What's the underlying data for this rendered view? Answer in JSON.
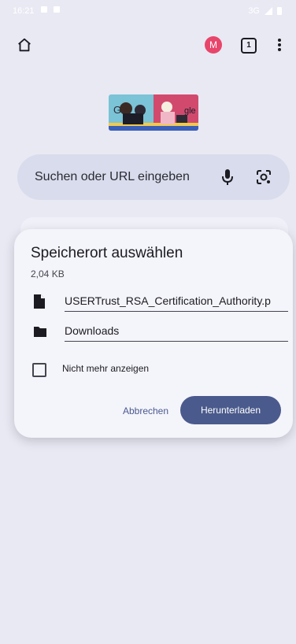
{
  "status_bar": {
    "time": "16:21",
    "network": "3G"
  },
  "toolbar": {
    "account_initial": "M",
    "tab_count": "1"
  },
  "search": {
    "placeholder": "Suchen oder URL eingeben"
  },
  "dialog": {
    "title": "Speicherort auswählen",
    "file_size": "2,04 KB",
    "file_name": "USERTrust_RSA_Certification_Authority.p",
    "folder": "Downloads",
    "checkbox_label": "Nicht mehr anzeigen",
    "checkbox_checked": false,
    "cancel_label": "Abbrechen",
    "download_label": "Herunterladen"
  },
  "colors": {
    "accent": "#4a5a8c",
    "background": "#e9e9f4",
    "avatar": "#e8456b"
  }
}
